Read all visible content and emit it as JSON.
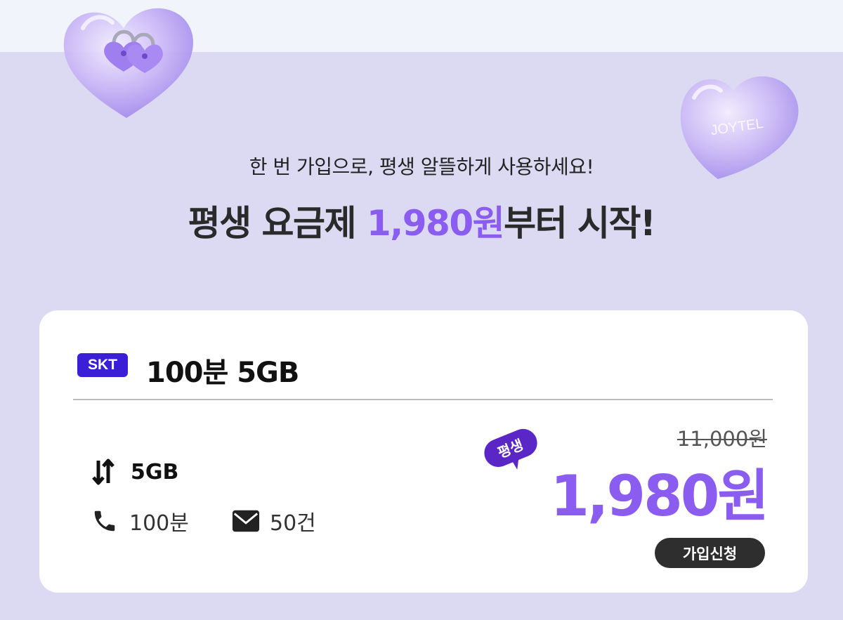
{
  "header": {
    "subtitle": "한 번 가입으로, 평생 알뜰하게 사용하세요!",
    "headline_prefix": "평생 요금제 ",
    "headline_price": "1,980원",
    "headline_suffix": "부터 시작!",
    "heart_right_text": "JOYTEL"
  },
  "plan": {
    "carrier": "SKT",
    "name": "100분 5GB",
    "data": "5GB",
    "voice": "100분",
    "messages": "50건",
    "lifetime_tag": "평생",
    "original_price": "11,000원",
    "price": "1,980원",
    "apply_label": "가입신청"
  },
  "icons": [
    "heart-padlock-icon",
    "heart-joytel-icon",
    "data-arrows-icon",
    "phone-icon",
    "mail-icon"
  ],
  "colors": {
    "background": "#dcdaf3",
    "top_band": "#f1f5fb",
    "accent": "#8b5cf0",
    "carrier_badge": "#3b1fd6",
    "apply_button": "#2e2e2e"
  }
}
